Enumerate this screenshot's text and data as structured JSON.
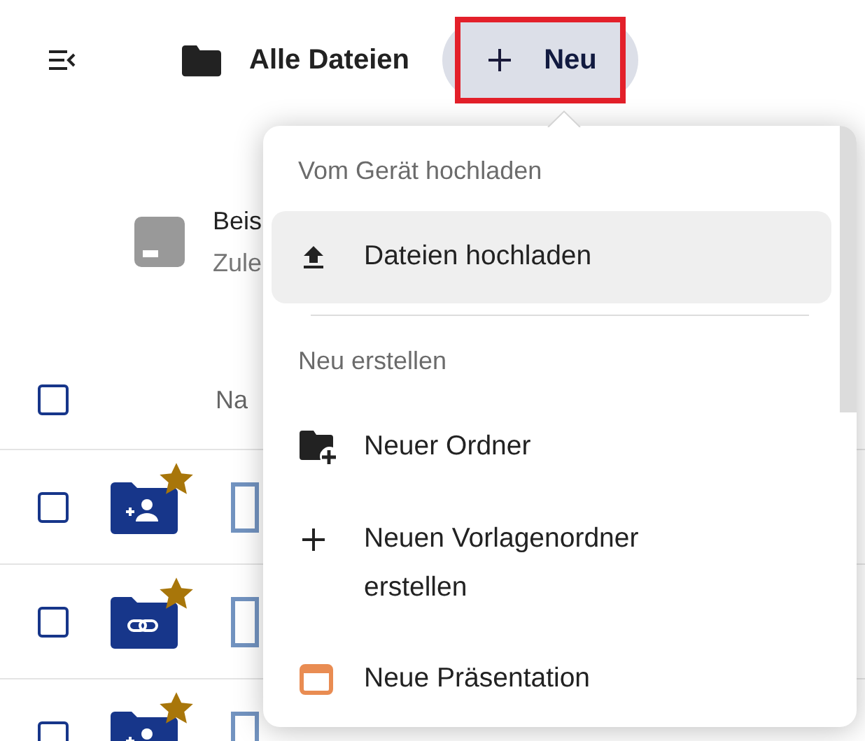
{
  "header": {
    "title": "Alle Dateien",
    "new_button": {
      "label": "Neu",
      "annotated": true
    }
  },
  "recent": {
    "title": "Beis",
    "subtitle": "Zule"
  },
  "table": {
    "header": {
      "checked": false,
      "name_column": "Na"
    },
    "rows": [
      {
        "checked": false,
        "kind": "shared",
        "starred": true
      },
      {
        "checked": false,
        "kind": "link",
        "starred": true
      },
      {
        "checked": false,
        "kind": "shared",
        "starred": true
      }
    ]
  },
  "menu": {
    "sections": [
      {
        "title": "Vom Gerät hochladen",
        "items": [
          {
            "label": "Dateien hochladen",
            "kind": "upload",
            "highlighted": true
          }
        ]
      },
      {
        "title": "Neu erstellen",
        "items": [
          {
            "label": "Neuer Ordner",
            "kind": "folder-plus",
            "highlighted": false
          },
          {
            "label": "Neuen Vorlagenordner erstellen",
            "kind": "plus",
            "highlighted": false
          },
          {
            "label": "Neue Präsentation",
            "kind": "presentation",
            "highlighted": false
          }
        ]
      }
    ]
  }
}
